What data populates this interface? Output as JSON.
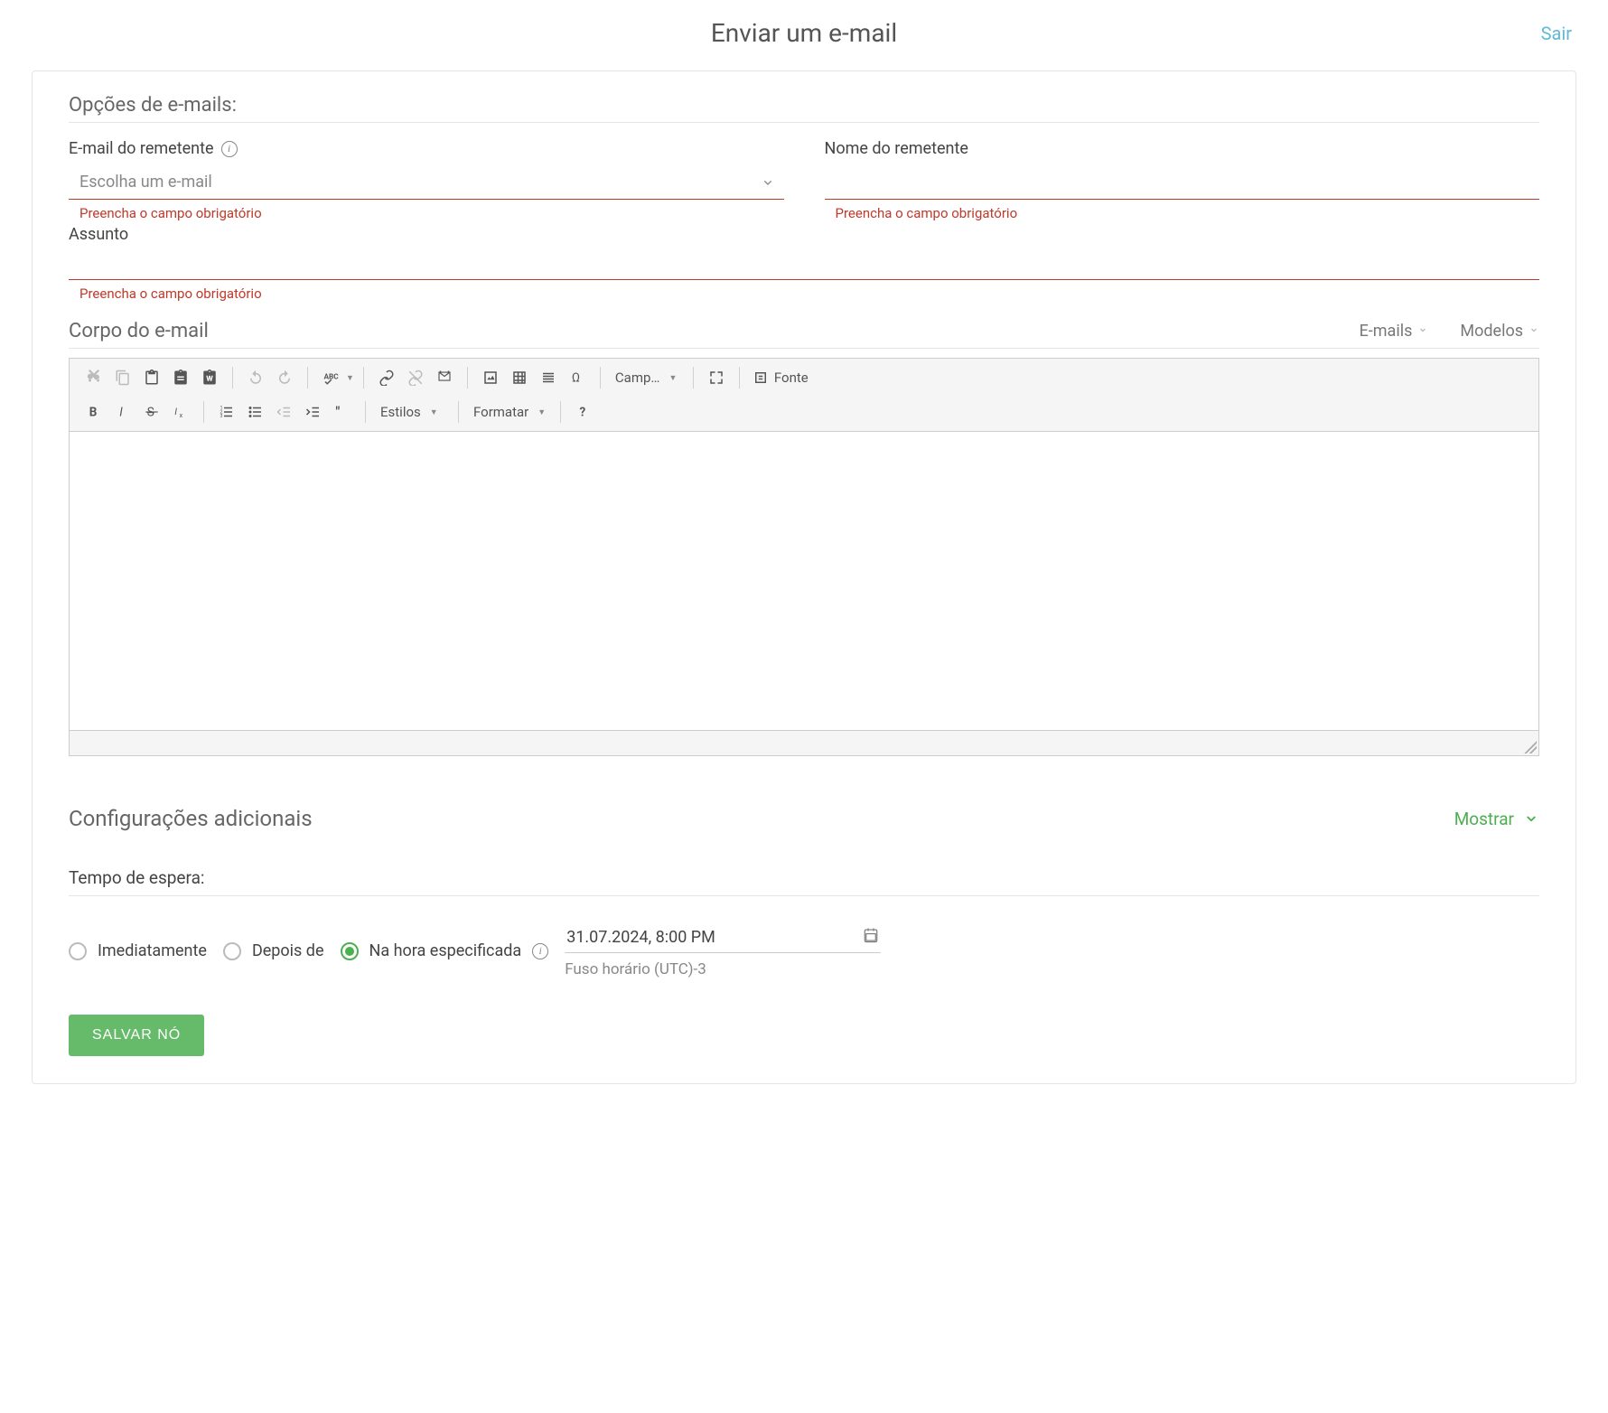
{
  "header": {
    "title": "Enviar um e-mail",
    "exit": "Sair"
  },
  "options": {
    "title": "Opções de e-mails:",
    "sender_email_label": "E-mail do remetente",
    "sender_email_placeholder": "Escolha um e-mail",
    "sender_email_error": "Preencha o campo obrigatório",
    "sender_name_label": "Nome do remetente",
    "sender_name_error": "Preencha o campo obrigatório",
    "subject_label": "Assunto",
    "subject_error": "Preencha o campo obrigatório"
  },
  "body": {
    "title": "Corpo do e-mail",
    "emails_btn": "E-mails",
    "templates_btn": "Modelos"
  },
  "toolbar": {
    "variables": "Camp…",
    "source": "Fonte",
    "styles": "Estilos",
    "format": "Formatar"
  },
  "settings": {
    "title": "Configurações adicionais",
    "show": "Mostrar"
  },
  "wait": {
    "title": "Tempo de espera:",
    "immediate": "Imediatamente",
    "after": "Depois de",
    "at_time": "Na hora especificada",
    "datetime": "31.07.2024, 8:00 PM",
    "timezone": "Fuso horário (UTC)-3",
    "selected": "at_time"
  },
  "actions": {
    "save": "SALVAR NÓ"
  }
}
